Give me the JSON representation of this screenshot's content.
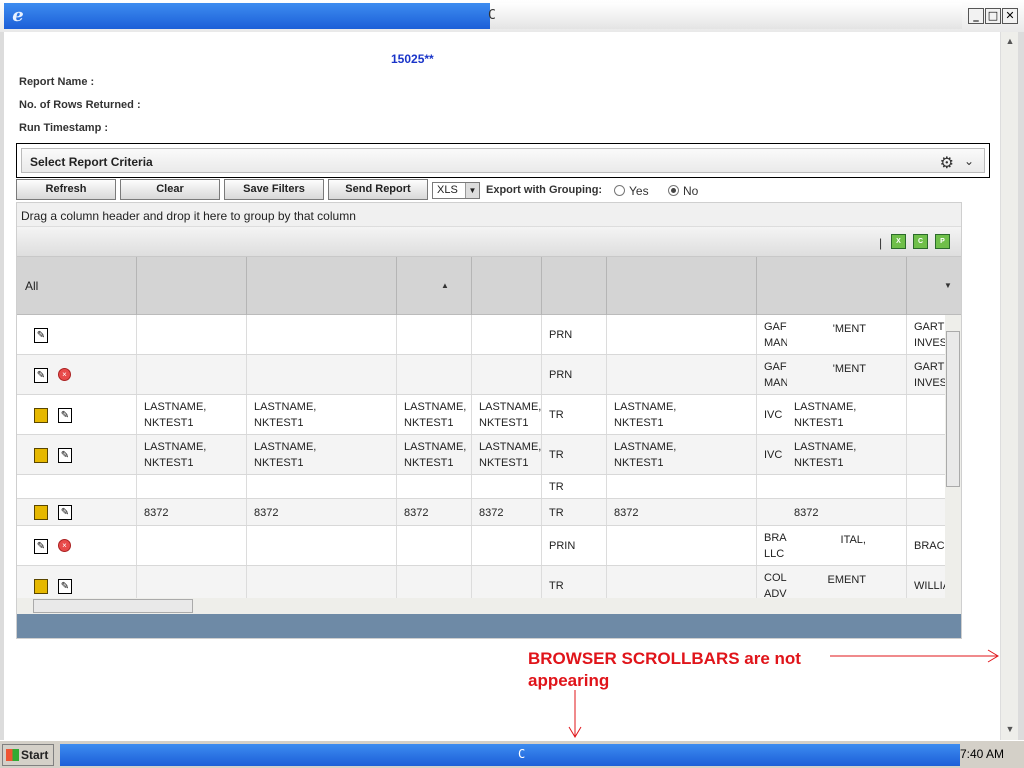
{
  "window": {
    "title_fragment": "C"
  },
  "header": {
    "report_id": "15025**",
    "report_name_label": "Report Name :",
    "rows_returned_label": "No. of Rows Returned :",
    "run_timestamp_label": "Run Timestamp :"
  },
  "criteria": {
    "label": "Select Report Criteria"
  },
  "toolbar": {
    "refresh_label": "Refresh",
    "clear_label": "Clear",
    "save_filters_label": "Save Filters",
    "send_report_label": "Send Report",
    "format_value": "XLS",
    "export_grouping_label": "Export with Grouping:",
    "yes_label": "Yes",
    "no_label": "No",
    "selected_option": "No"
  },
  "grid": {
    "group_hint": "Drag a column header and drop it here to group by that column",
    "separator": "|",
    "export_icons": [
      "xls",
      "csv",
      "pdf"
    ],
    "all_label": "All",
    "rows": [
      {
        "icons": [
          "edit-icon"
        ],
        "c": [
          "",
          "",
          "",
          "",
          "PRN",
          "",
          "GAF\nMAN",
          "'MENT",
          "GART\nINVES"
        ]
      },
      {
        "icons": [
          "edit-icon",
          "delete-icon"
        ],
        "c": [
          "",
          "",
          "",
          "",
          "PRN",
          "",
          "GAF\nMAN",
          "'MENT",
          "GART\nINVES"
        ]
      },
      {
        "icons": [
          "note-icon",
          "edit-icon"
        ],
        "c": [
          "LASTNAME,\nNKTEST1",
          "LASTNAME,\nNKTEST1",
          "LASTNAME,\nNKTEST1",
          "LASTNAME,\nNKTEST1",
          "TR",
          "LASTNAME,\nNKTEST1",
          "IVC",
          "LASTNAME,\nNKTEST1",
          ""
        ]
      },
      {
        "icons": [
          "note-icon",
          "edit-icon"
        ],
        "c": [
          "LASTNAME,\nNKTEST1",
          "LASTNAME,\nNKTEST1",
          "LASTNAME,\nNKTEST1",
          "LASTNAME,\nNKTEST1",
          "TR",
          "LASTNAME,\nNKTEST1",
          "IVC",
          "LASTNAME,\nNKTEST1",
          ""
        ]
      },
      {
        "icons": [],
        "c": [
          "",
          "",
          "",
          "",
          "TR",
          "",
          "",
          "",
          ""
        ]
      },
      {
        "icons": [
          "note-icon",
          "edit-icon"
        ],
        "c": [
          "8372",
          "8372",
          "8372",
          "8372",
          "TR",
          "8372",
          "",
          "8372",
          ""
        ]
      },
      {
        "icons": [
          "edit-icon",
          "delete-icon"
        ],
        "c": [
          "",
          "",
          "",
          "",
          "PRIN",
          "",
          "BRA\nLLC",
          "ITAL,",
          "BRAC"
        ]
      },
      {
        "icons": [
          "note-icon",
          "edit-icon"
        ],
        "c": [
          "",
          "",
          "",
          "",
          "TR",
          "",
          "COL\nADV",
          "EMENT",
          "WILLIA"
        ]
      }
    ]
  },
  "annotation": {
    "text": "BROWSER SCROLLBARS are not appearing"
  },
  "taskbar": {
    "start_label": "Start",
    "center_fragment": "C",
    "clock": "7:40 AM"
  }
}
